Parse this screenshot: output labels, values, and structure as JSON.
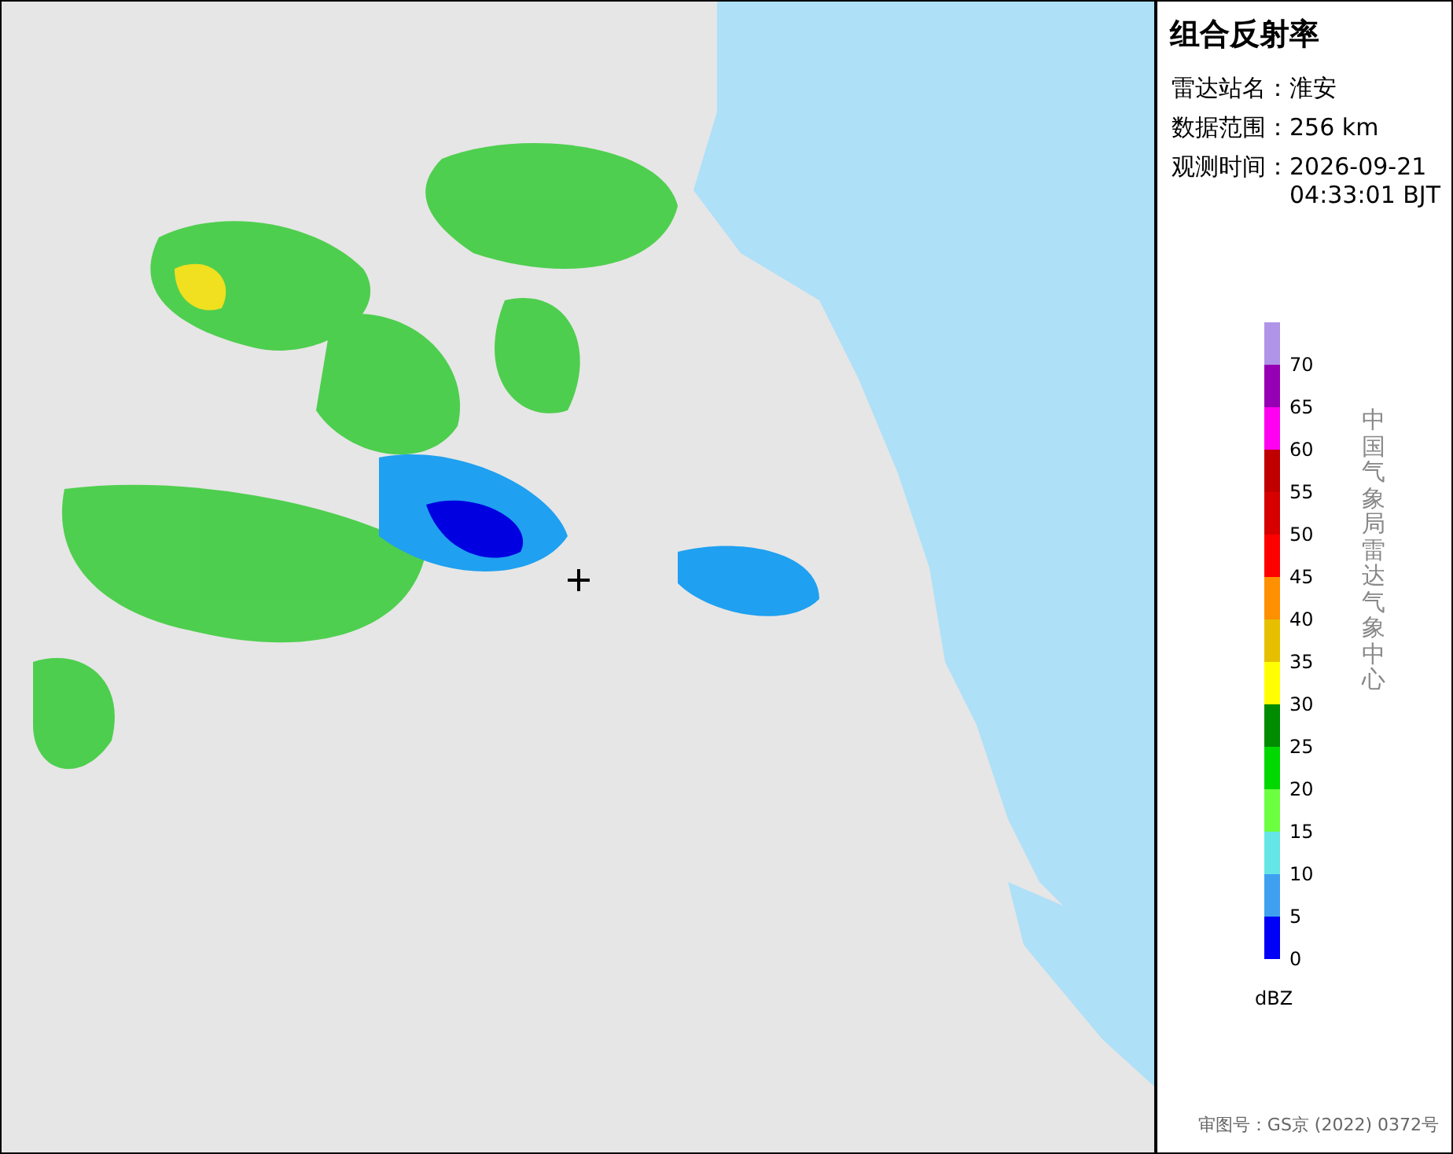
{
  "panel": {
    "title": "组合反射率",
    "fields": [
      {
        "label": "雷达站名：",
        "value": "淮安"
      },
      {
        "label": "数据范围：",
        "value": "256 km"
      },
      {
        "label": "观测时间：",
        "value": "2026-09-21 04:33:01 BJT"
      }
    ],
    "legend": {
      "unit": "dBZ",
      "items": [
        {
          "label": "70",
          "color": "#b094e8"
        },
        {
          "label": "65",
          "color": "#9600b4"
        },
        {
          "label": "60",
          "color": "#ff00f0"
        },
        {
          "label": "55",
          "color": "#c00000"
        },
        {
          "label": "50",
          "color": "#d60000"
        },
        {
          "label": "45",
          "color": "#ff0000"
        },
        {
          "label": "40",
          "color": "#ff9000"
        },
        {
          "label": "35",
          "color": "#e6c000"
        },
        {
          "label": "30",
          "color": "#ffff00"
        },
        {
          "label": "25",
          "color": "#008c00"
        },
        {
          "label": "20",
          "color": "#00d800"
        },
        {
          "label": "15",
          "color": "#6cff40"
        },
        {
          "label": "10",
          "color": "#64e6e6"
        },
        {
          "label": "5",
          "color": "#40a0f0"
        },
        {
          "label": "0",
          "color": "#0000f6"
        }
      ]
    },
    "source": "中国气象局雷达气象中心",
    "approval": "审图号：GS京 (2022) 0372号"
  }
}
